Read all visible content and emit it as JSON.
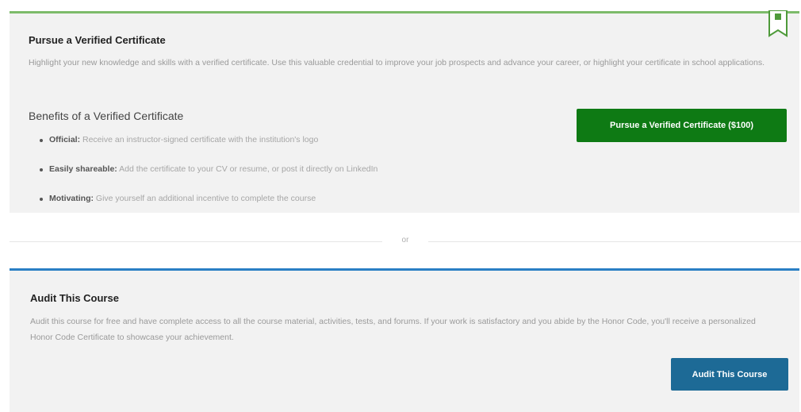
{
  "colors": {
    "verified_accent": "#7dbb6a",
    "verified_button": "#0e7a14",
    "audit_accent": "#2a7fc4",
    "audit_button": "#1d6a96",
    "card_background": "#f2f2f2"
  },
  "verified": {
    "icon": "certificate-ribbon-icon",
    "title": "Pursue a Verified Certificate",
    "description": "Highlight your new knowledge and skills with a verified certificate. Use this valuable credential to improve your job prospects and advance your career, or highlight your certificate in school applications.",
    "benefits_title": "Benefits of a Verified Certificate",
    "benefits": [
      {
        "name": "Official:",
        "text": " Receive an instructor-signed certificate with the institution's logo"
      },
      {
        "name": "Easily shareable:",
        "text": " Add the certificate to your CV or resume, or post it directly on LinkedIn"
      },
      {
        "name": "Motivating:",
        "text": " Give yourself an additional incentive to complete the course"
      }
    ],
    "button_label": "Pursue a Verified Certificate ($100)"
  },
  "divider": {
    "text": "or"
  },
  "audit": {
    "title": "Audit This Course",
    "description": "Audit this course for free and have complete access to all the course material, activities, tests, and forums. If your work is satisfactory and you abide by the Honor Code, you'll receive a personalized Honor Code Certificate to showcase your achievement.",
    "button_label": "Audit This Course"
  }
}
